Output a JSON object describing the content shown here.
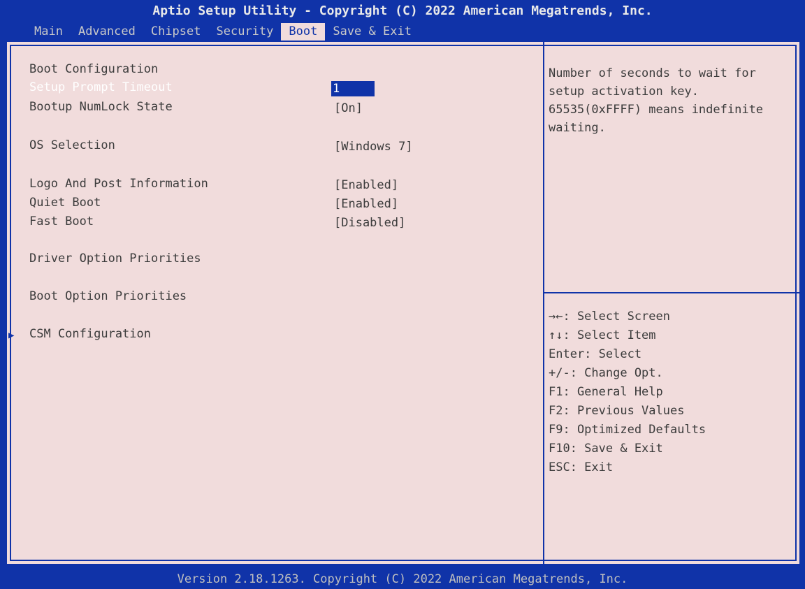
{
  "header": {
    "title": "Aptio Setup Utility - Copyright (C) 2022 American Megatrends, Inc.",
    "tabs": [
      {
        "label": "Main"
      },
      {
        "label": "Advanced"
      },
      {
        "label": "Chipset"
      },
      {
        "label": "Security"
      },
      {
        "label": "Boot"
      },
      {
        "label": "Save & Exit"
      }
    ],
    "active_tab": "Boot"
  },
  "main": {
    "boot_configuration": "Boot Configuration",
    "settings": [
      {
        "label": "Setup Prompt Timeout",
        "value": "1"
      },
      {
        "label": "Bootup NumLock State",
        "value": "[On]"
      },
      {
        "label": "OS Selection",
        "value": "[Windows 7]"
      },
      {
        "label": "Logo And Post Information",
        "value": "[Enabled]"
      },
      {
        "label": "Quiet Boot",
        "value": "[Enabled]"
      },
      {
        "label": "Fast Boot",
        "value": "[Disabled]"
      }
    ],
    "driver_option_priorities": "Driver Option Priorities",
    "boot_option_priorities": "Boot Option Priorities",
    "csm_configuration": "CSM Configuration",
    "submenu_arrow": "▶"
  },
  "help": {
    "lines": [
      "Number of seconds to wait for",
      "setup activation key.",
      "65535(0xFFFF) means indefinite",
      "waiting."
    ]
  },
  "keys": [
    "→←: Select Screen",
    "↑↓: Select Item",
    "Enter: Select",
    "+/-: Change Opt.",
    "F1: General Help",
    "F2: Previous Values",
    "F9: Optimized Defaults",
    "F10: Save & Exit",
    "ESC: Exit"
  ],
  "footer": {
    "version": "Version 2.18.1263. Copyright (C) 2022 American Megatrends, Inc."
  },
  "colors": {
    "frame_blue": "#1033a8",
    "panel_bg": "#f1dcdc",
    "text_dark": "#3c3c3c",
    "highlight_text": "#ffffff"
  }
}
